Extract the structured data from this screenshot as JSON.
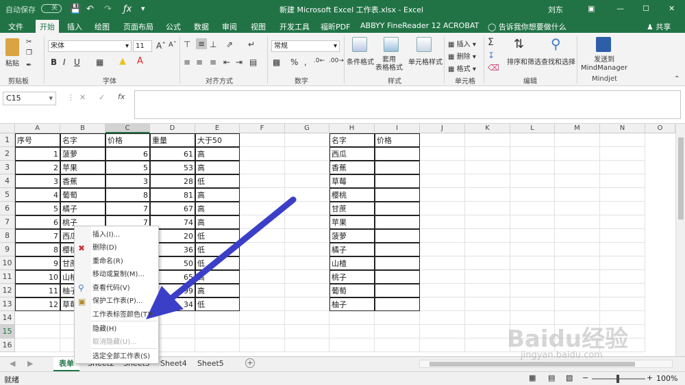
{
  "titlebar": {
    "autosave": "自动保存",
    "autosave_state": "关",
    "title": "新建 Microsoft Excel 工作表.xlsx  -  Excel",
    "user": "刘东",
    "share": "共享"
  },
  "tabs": [
    "文件",
    "开始",
    "插入",
    "绘图",
    "页面布局",
    "公式",
    "数据",
    "审阅",
    "视图",
    "开发工具",
    "福昕PDF",
    "ABBYY FineReader 12",
    "ACROBAT"
  ],
  "tell_me": "告诉我你想要做什么",
  "ribbon": {
    "clipboard": {
      "label": "剪贴板",
      "paste": "粘贴"
    },
    "font": {
      "label": "字体",
      "name": "宋体",
      "size": "11"
    },
    "align": {
      "label": "对齐方式"
    },
    "number": {
      "label": "数字",
      "format": "常规"
    },
    "styles": {
      "label": "样式",
      "cond": "条件格式",
      "table": "套用\n表格格式",
      "cell": "单元格样式"
    },
    "cells": {
      "label": "单元格",
      "insert": "插入",
      "delete": "删除",
      "format": "格式"
    },
    "editing": {
      "label": "编辑",
      "sort": "排序和筛选",
      "find": "查找和选择"
    },
    "mindjet": {
      "label": "Mindjet",
      "send": "发送到\nMindManager"
    }
  },
  "formula_bar": {
    "namebox": "C15",
    "fx": "fx",
    "value": ""
  },
  "columns": [
    "A",
    "B",
    "C",
    "D",
    "E",
    "F",
    "G",
    "H",
    "I",
    "J",
    "K",
    "L",
    "M",
    "N",
    "O"
  ],
  "rows": [
    "1",
    "2",
    "3",
    "4",
    "5",
    "6",
    "7",
    "8",
    "9",
    "10",
    "11",
    "12",
    "13",
    "14",
    "15",
    "16"
  ],
  "table1": {
    "headers": [
      "序号",
      "名字",
      "价格",
      "重量",
      "大于50"
    ],
    "data": [
      [
        "1",
        "菠萝",
        "6",
        "61",
        "高"
      ],
      [
        "2",
        "苹果",
        "5",
        "53",
        "高"
      ],
      [
        "3",
        "香蕉",
        "3",
        "28",
        "低"
      ],
      [
        "4",
        "葡萄",
        "8",
        "81",
        "高"
      ],
      [
        "5",
        "橘子",
        "7",
        "67",
        "高"
      ],
      [
        "6",
        "桃子",
        "7",
        "74",
        "高"
      ],
      [
        "7",
        "西瓜",
        "",
        "20",
        "低"
      ],
      [
        "8",
        "樱桃",
        "",
        "36",
        "低"
      ],
      [
        "9",
        "甘蔗",
        "",
        "50",
        "低"
      ],
      [
        "10",
        "山楂",
        "",
        "65",
        "高"
      ],
      [
        "11",
        "柚子",
        "",
        "99",
        "高"
      ],
      [
        "12",
        "草莓",
        "",
        "34",
        "低"
      ]
    ]
  },
  "table2": {
    "headers": [
      "名字",
      "价格"
    ],
    "names": [
      "西瓜",
      "香蕉",
      "草莓",
      "樱桃",
      "甘蔗",
      "苹果",
      "菠萝",
      "橘子",
      "山楂",
      "桃子",
      "葡萄",
      "柚子"
    ]
  },
  "context_menu": [
    {
      "label": "插入(I)...",
      "disabled": false
    },
    {
      "label": "删除(D)",
      "disabled": false
    },
    {
      "label": "重命名(R)",
      "disabled": false
    },
    {
      "label": "移动或复制(M)...",
      "disabled": false
    },
    {
      "label": "查看代码(V)",
      "disabled": false
    },
    {
      "label": "保护工作表(P)...",
      "disabled": false
    },
    {
      "label": "工作表标签颜色(T)",
      "disabled": false
    },
    {
      "label": "隐藏(H)",
      "disabled": false
    },
    {
      "label": "取消隐藏(U)...",
      "disabled": true
    },
    {
      "label": "选定全部工作表(S)",
      "disabled": false
    }
  ],
  "sheets": [
    "表单",
    "Sheet2",
    "Sheet3",
    "Sheet4",
    "Sheet5"
  ],
  "status": {
    "ready": "就绪",
    "zoom": "100%"
  },
  "watermark": {
    "brand": "Baidu经验",
    "url": "jingyan.baidu.com"
  },
  "colors": {
    "excel_green": "#217346",
    "arrow": "#3b3fc8"
  }
}
